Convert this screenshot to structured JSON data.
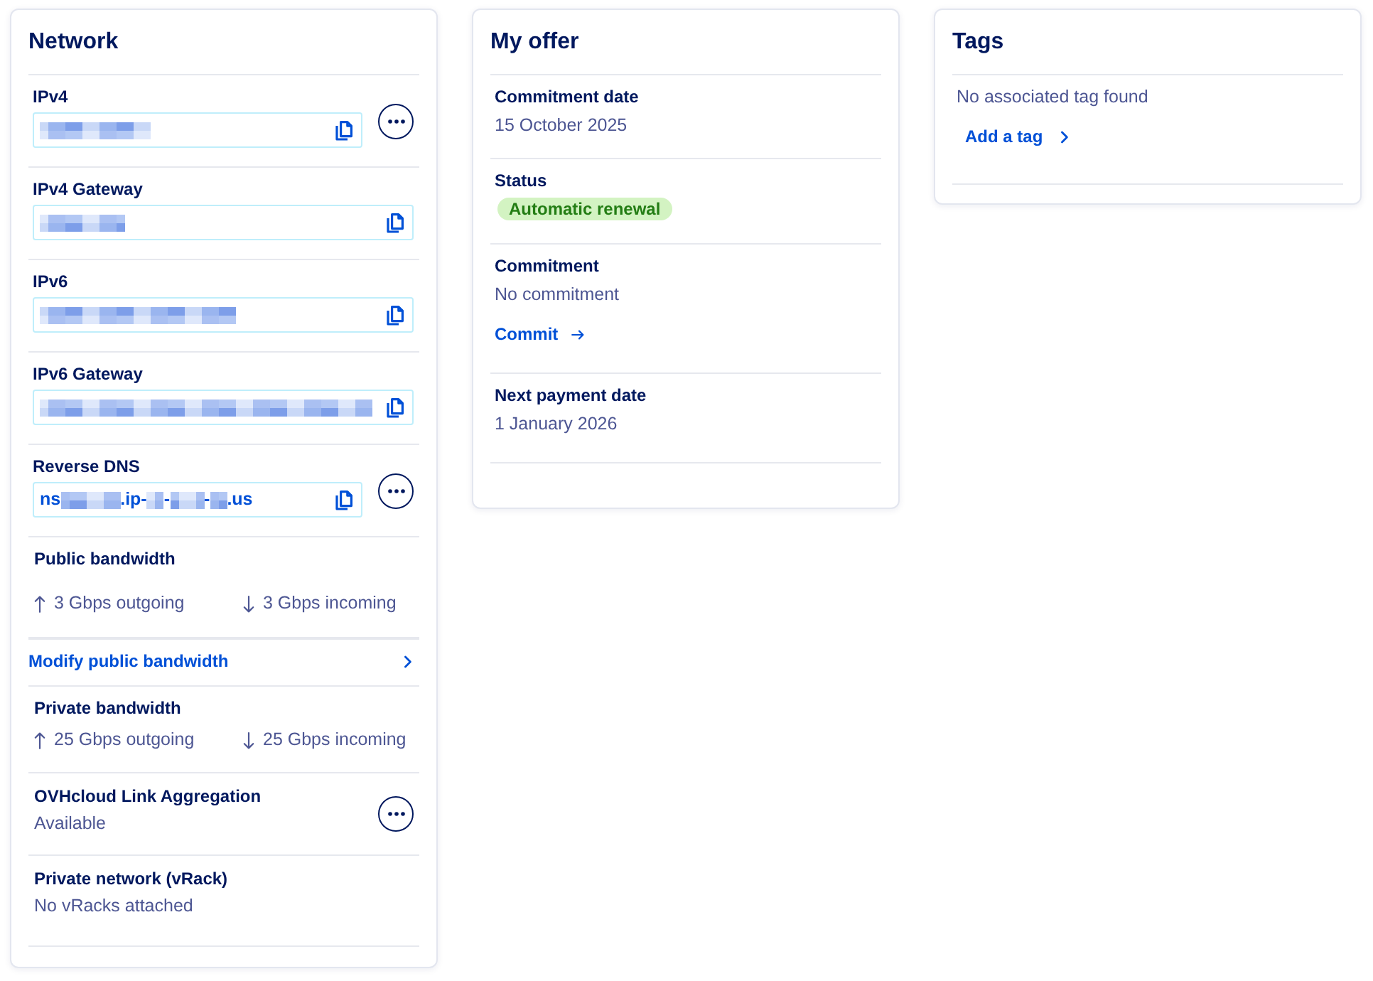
{
  "cards": [
    {
      "kind": "network",
      "title": "Network",
      "rows": [
        {
          "kind": "field",
          "label": "IPv4",
          "value": [
            {
              "kind": "redacted"
            }
          ],
          "menu": true
        },
        {
          "kind": "field",
          "label": "IPv4 Gateway",
          "value": [
            {
              "kind": "redacted"
            }
          ],
          "menu": false
        },
        {
          "kind": "field",
          "label": "IPv6",
          "value": [
            {
              "kind": "redacted"
            }
          ],
          "menu": false
        },
        {
          "kind": "field",
          "label": "IPv6 Gateway",
          "value": [
            {
              "kind": "redacted"
            }
          ],
          "menu": false
        },
        {
          "kind": "field",
          "label": "Reverse DNS",
          "value": [
            {
              "kind": "text",
              "text": "ns"
            },
            {
              "kind": "redacted"
            },
            {
              "kind": "text",
              "text": ".ip-"
            },
            {
              "kind": "redacted"
            },
            {
              "kind": "text",
              "text": "-"
            },
            {
              "kind": "redacted"
            },
            {
              "kind": "text",
              "text": "-"
            },
            {
              "kind": "redacted"
            },
            {
              "kind": "text",
              "text": ".us"
            }
          ],
          "menu": true
        },
        {
          "kind": "bandwidth",
          "label": "Public bandwidth",
          "outgoing": "3 Gbps outgoing",
          "incoming": "3 Gbps incoming"
        },
        {
          "kind": "link",
          "text": "Modify public bandwidth"
        },
        {
          "kind": "bandwidth",
          "label": "Private bandwidth",
          "outgoing": "25 Gbps outgoing",
          "incoming": "25 Gbps incoming"
        },
        {
          "kind": "info",
          "label": "OVHcloud Link Aggregation",
          "value": "Available",
          "menu": true
        },
        {
          "kind": "info",
          "label": "Private network (vRack)",
          "value": "No vRacks attached",
          "menu": false
        }
      ]
    },
    {
      "kind": "offer",
      "title": "My offer",
      "rows": [
        {
          "kind": "text",
          "label": "Commitment date",
          "value": "15 October 2025"
        },
        {
          "kind": "badge",
          "label": "Status",
          "badge": {
            "text": "Automatic renewal",
            "kind": "success"
          }
        },
        {
          "kind": "text",
          "label": "Commitment",
          "value": "No commitment",
          "link": "Commit"
        },
        {
          "kind": "text",
          "label": "Next payment date",
          "value": "1 January 2026"
        }
      ]
    },
    {
      "kind": "tags",
      "title": "Tags",
      "rows": [
        {
          "kind": "message",
          "text": "No associated tag found",
          "link": "Add a tag"
        }
      ]
    }
  ]
}
